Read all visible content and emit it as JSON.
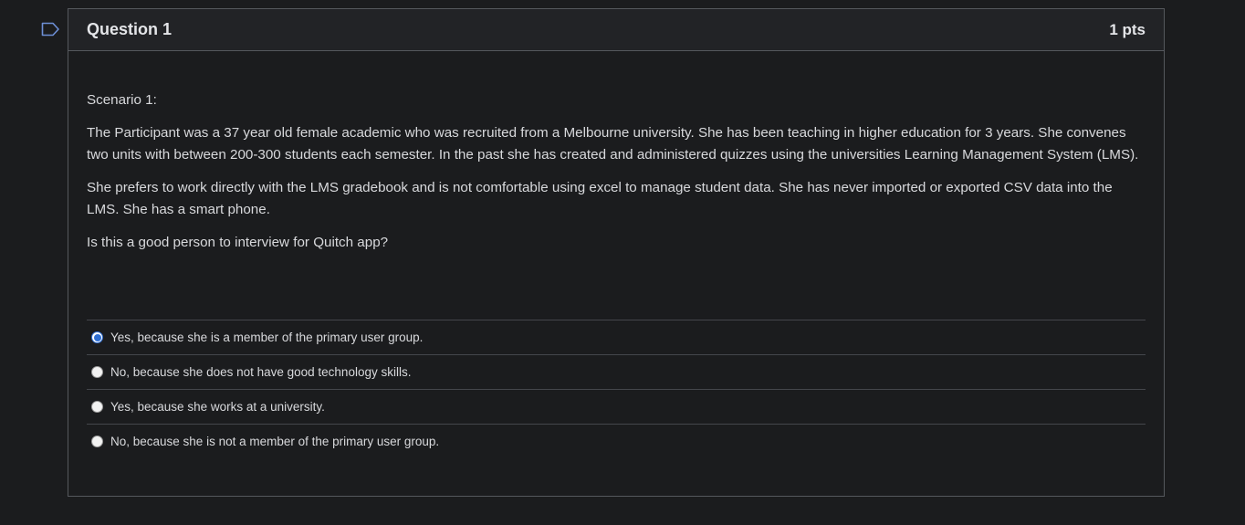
{
  "question": {
    "title": "Question 1",
    "points": "1 pts",
    "paragraphs": [
      "Scenario 1:",
      "The Participant was a 37 year old female academic who was recruited from a Melbourne university. She has been teaching in higher education for 3 years. She convenes two units with between 200-300 students each semester.  In the past she has created and administered quizzes using the universities Learning Management System (LMS).",
      "She prefers to work directly with the LMS gradebook and is not comfortable using excel to manage student data. She has never imported or exported CSV data into the LMS. She has a smart phone.",
      "Is this a good person to interview for Quitch app?"
    ],
    "answers": [
      {
        "label": "Yes, because she is a member of the primary user group.",
        "selected": true
      },
      {
        "label": "No, because she does not have good technology skills.",
        "selected": false
      },
      {
        "label": "Yes, because she works at a university.",
        "selected": false
      },
      {
        "label": "No, because she is not a member of the primary user group.",
        "selected": false
      }
    ],
    "flag_icon": "bookmark-flag-icon"
  },
  "colors": {
    "background": "#1b1c1e",
    "border": "#55585d",
    "radio_selected": "#2f6fd3"
  }
}
